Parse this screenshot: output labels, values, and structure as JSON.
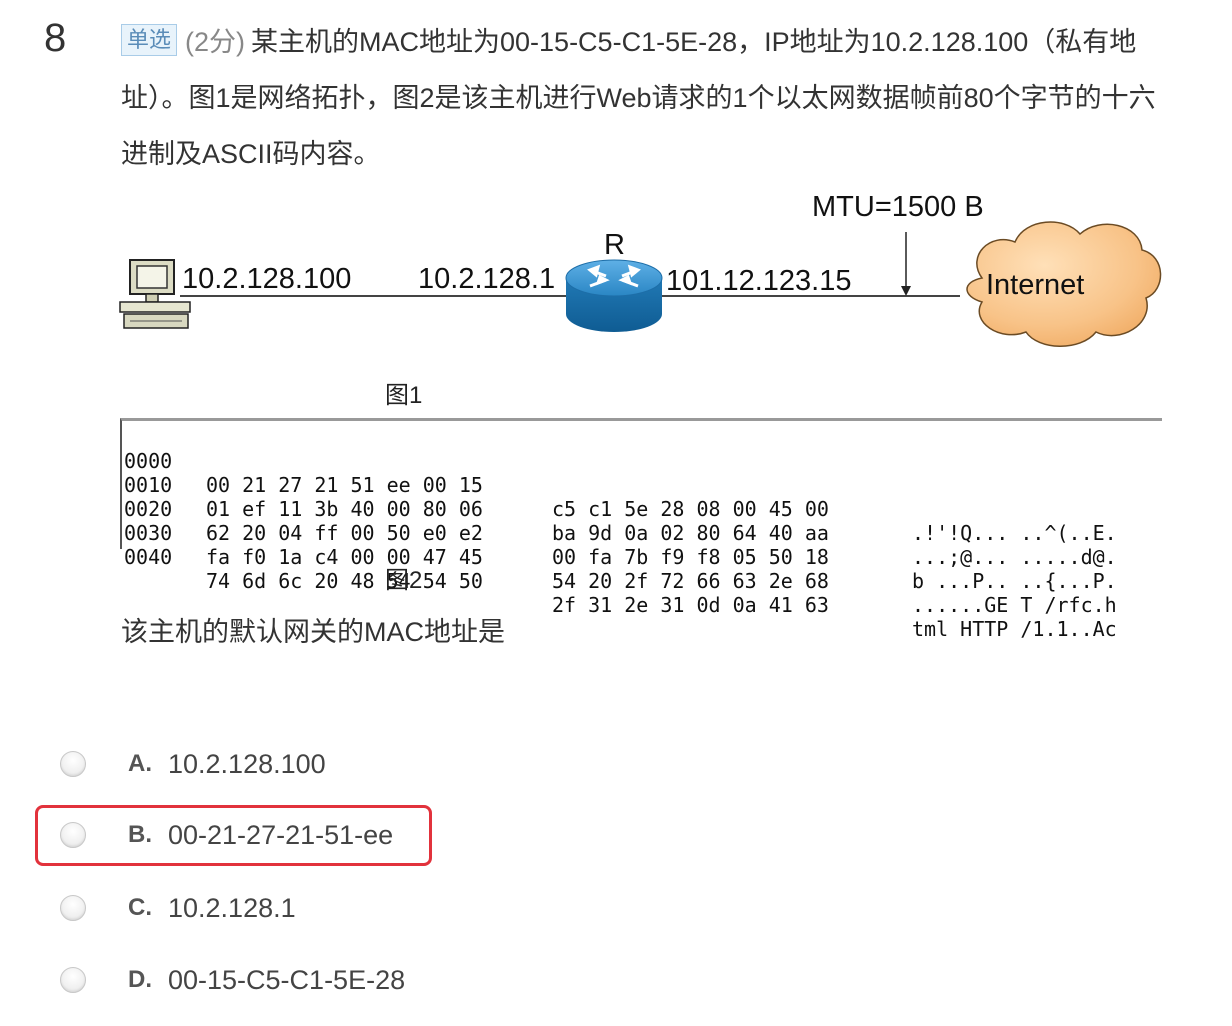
{
  "question": {
    "number": "8",
    "type_badge": "单选",
    "points": "(2分)",
    "stem_line1": "某主机的MAC地址为00-15-C5-C1-5E-28，IP地址为10.2.128.100（私有地",
    "stem_line2": "址）。图1是网络拓扑，图2是该主机进行Web请求的1个以太网数据帧前80个字节的十六",
    "stem_line3": "进制及ASCII码内容。",
    "prompt": "该主机的默认网关的MAC地址是"
  },
  "figure1": {
    "caption": "图1",
    "host_ip": "10.2.128.100",
    "router_inner_ip": "10.2.128.1",
    "router_label": "R",
    "router_outer_ip": "101.12.123.15",
    "mtu_label": "MTU=1500 B",
    "cloud_label": "Internet",
    "icons": [
      "computer-icon",
      "router-icon",
      "internet-cloud-icon"
    ]
  },
  "figure2": {
    "caption": "图2",
    "rows": [
      {
        "offset": "0000",
        "bytes1": "00 21 27 21 51 ee 00 15",
        "bytes2": "c5 c1 5e 28 08 00 45 00",
        "ascii": ".!'!Q... ..^(..E."
      },
      {
        "offset": "0010",
        "bytes1": "01 ef 11 3b 40 00 80 06",
        "bytes2": "ba 9d 0a 02 80 64 40 aa",
        "ascii": "...;@... .....d@."
      },
      {
        "offset": "0020",
        "bytes1": "62 20 04 ff 00 50 e0 e2",
        "bytes2": "00 fa 7b f9 f8 05 50 18",
        "ascii": "b ...P.. ..{...P."
      },
      {
        "offset": "0030",
        "bytes1": "fa f0 1a c4 00 00 47 45",
        "bytes2": "54 20 2f 72 66 63 2e 68",
        "ascii": "......GE T /rfc.h"
      },
      {
        "offset": "0040",
        "bytes1": "74 6d 6c 20 48 54 54 50",
        "bytes2": "2f 31 2e 31 0d 0a 41 63",
        "ascii": "tml HTTP /1.1..Ac"
      }
    ]
  },
  "options": [
    {
      "letter": "A.",
      "text": "10.2.128.100"
    },
    {
      "letter": "B.",
      "text": "00-21-27-21-51-ee"
    },
    {
      "letter": "C.",
      "text": "10.2.128.1"
    },
    {
      "letter": "D.",
      "text": "00-15-C5-C1-5E-28"
    }
  ],
  "colors": {
    "highlight_border": "#e2323c",
    "badge_bg": "#e8f3fb",
    "router_blue": "#2a86c4",
    "cloud_orange": "#f6b66e"
  }
}
